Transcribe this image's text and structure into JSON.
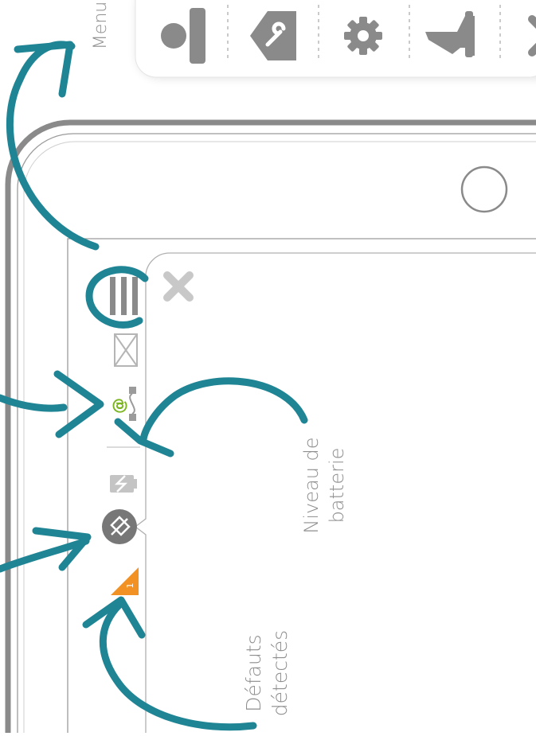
{
  "labels": {
    "menu": "Menu",
    "battery": [
      "Niveau de",
      "batterie"
    ],
    "faults": [
      "Défauts",
      "détectés"
    ],
    "connection_symbol": "@",
    "alert_count": "1"
  },
  "toolbar": {
    "icons": [
      "person-icon",
      "wrench-tag-icon",
      "gear-icon",
      "vacuum-icon",
      "close-icon"
    ]
  },
  "colors": {
    "annotation": "#1f8494",
    "device_frame": "#8a8a8a",
    "icon_gray": "#8a8a8a",
    "connection_green": "#7ab51d",
    "alert_orange": "#f29224",
    "battery_gray": "#bdbdbd"
  }
}
